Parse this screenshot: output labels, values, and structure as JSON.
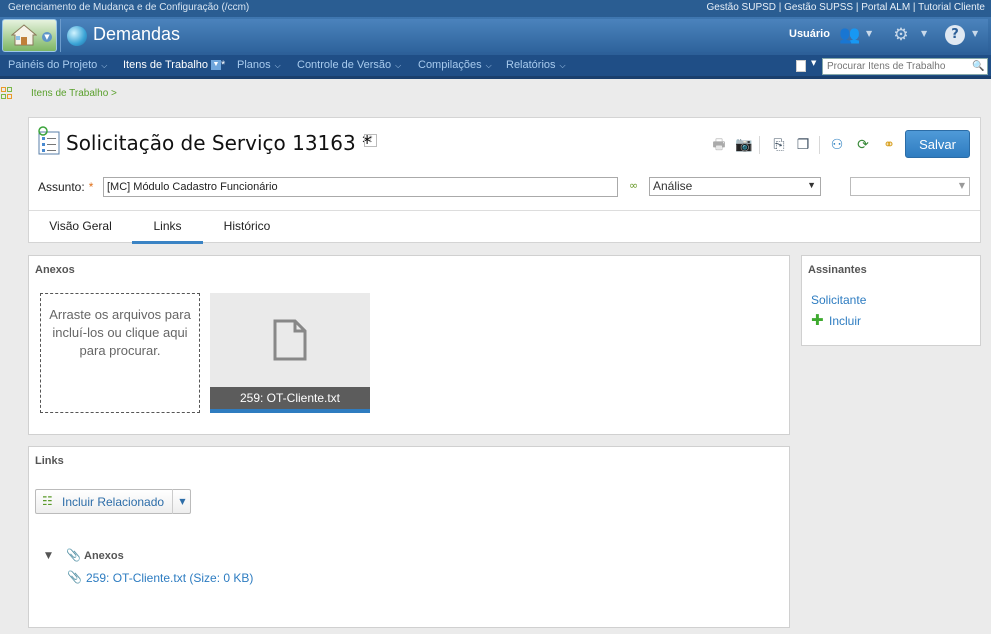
{
  "topbar": {
    "left": "Gerenciamento de Mudança e de Configuração (/ccm)",
    "right": "Gestão SUPSD | Gestão SUPSS | Portal ALM | Tutorial Cliente"
  },
  "header": {
    "title": "Demandas",
    "user": "Usuário"
  },
  "nav": {
    "items": [
      {
        "label": "Painéis do Projeto"
      },
      {
        "label": "Itens de Trabalho",
        "active": true,
        "dirty": "*"
      },
      {
        "label": "Planos"
      },
      {
        "label": "Controle de Versão"
      },
      {
        "label": "Compilações"
      },
      {
        "label": "Relatórios"
      }
    ],
    "search_placeholder": "Procurar Itens de Trabalho"
  },
  "breadcrumb": "Itens de Trabalho >",
  "workitem": {
    "title": "Solicitação de Serviço 13163 *",
    "save_label": "Salvar",
    "subject_label": "Assunto:",
    "required_mark": "*",
    "subject_value": "[MC] Módulo Cadastro Funcionário",
    "state": "Análise",
    "tabs": [
      "Visão Geral",
      "Links",
      "Histórico"
    ],
    "active_tab": "Links"
  },
  "attachments": {
    "title": "Anexos",
    "drop_text": "Arraste os arquivos para incluí-los ou clique aqui para procurar.",
    "file_caption": "259: OT-Cliente.txt"
  },
  "subscribers": {
    "title": "Assinantes",
    "requester": "Solicitante",
    "add_label": "Incluir"
  },
  "links": {
    "title": "Links",
    "add_related": "Incluir Relacionado",
    "tree_group": "Anexos",
    "tree_item": "259: OT-Cliente.txt (Size: 0 KB)"
  },
  "colors": {
    "accent": "#2f7cc0",
    "header": "#2c5f98",
    "nav": "#1f4e86",
    "link": "#2d7cc1",
    "breadcrumb": "#5aa02c"
  }
}
